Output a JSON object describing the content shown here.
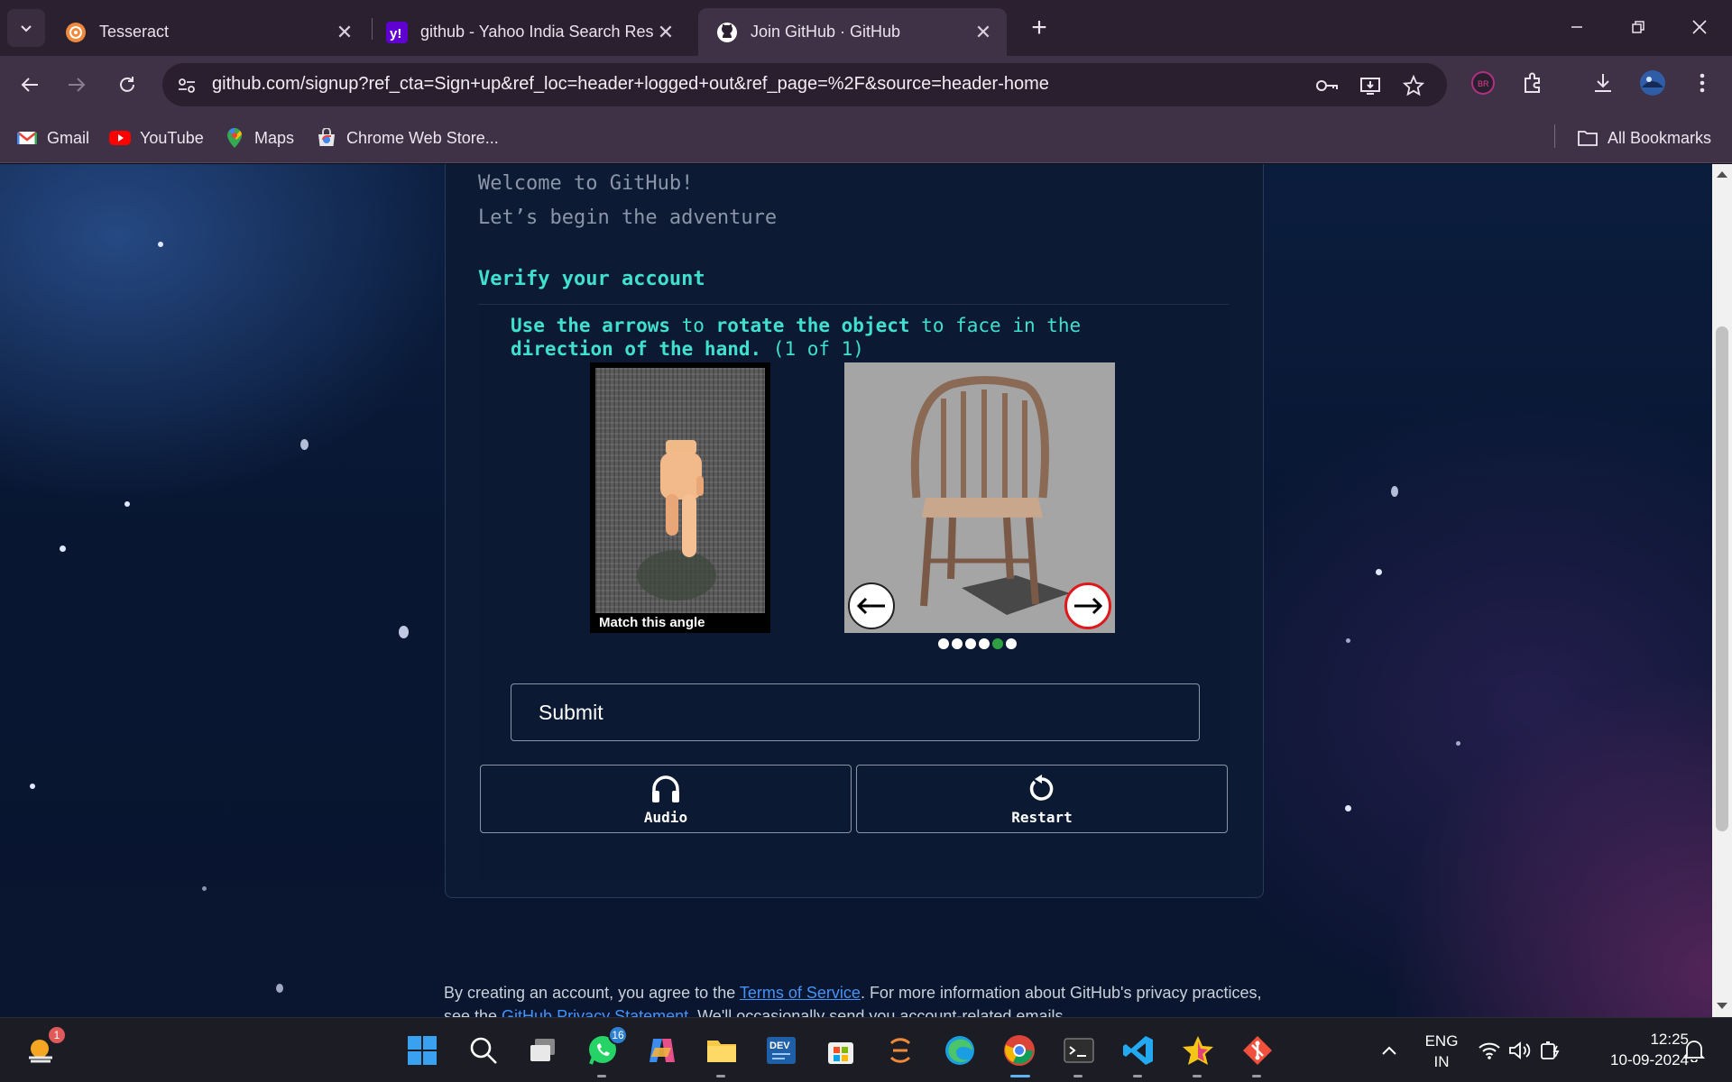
{
  "browser": {
    "tabs": [
      {
        "title": "Tesseract",
        "icon": "tesseract-icon",
        "active": false
      },
      {
        "title": "github - Yahoo India Search Res",
        "icon": "yahoo-icon",
        "active": false
      },
      {
        "title": "Join GitHub · GitHub",
        "icon": "github-icon",
        "active": true
      }
    ],
    "url": "github.com/signup?ref_cta=Sign+up&ref_loc=header+logged+out&ref_page=%2F&source=header-home",
    "bookmarks": [
      {
        "label": "Gmail",
        "icon": "gmail-icon"
      },
      {
        "label": "YouTube",
        "icon": "youtube-icon"
      },
      {
        "label": "Maps",
        "icon": "maps-icon"
      },
      {
        "label": "Chrome Web Store...",
        "icon": "chrome-web-store-icon"
      }
    ],
    "all_bookmarks": "All Bookmarks",
    "profile_badge": "BR"
  },
  "signup": {
    "welcome": "Welcome to GitHub!",
    "subtitle": "Let’s begin the adventure",
    "verify_heading": "Verify your account",
    "instruction": {
      "part1": "Use the arrows",
      "part2": " to ",
      "part3": "rotate the object",
      "part4": " to face in the ",
      "part5": "direction of the hand.",
      "part6": " (1 of 1)"
    },
    "match_label": "Match this angle",
    "progress": {
      "total": 6,
      "current": 5
    },
    "submit_label": "Submit",
    "audio_label": "Audio",
    "restart_label": "Restart",
    "terms_prefix": "By creating an account, you agree to the ",
    "terms_link": "Terms of Service",
    "terms_suffix": ". For more information about GitHub's privacy practices,",
    "terms_line2_prefix": "see the ",
    "privacy_link": "GitHub Privacy Statement",
    "terms_line2_suffix": ". We'll occasionally send you account-related emails."
  },
  "taskbar": {
    "weather_badge": "1",
    "whatsapp_badge": "16",
    "language": "ENG",
    "region": "IN",
    "time": "12:25",
    "date": "10-09-2024"
  },
  "colors": {
    "accent_teal": "#3fe0cf",
    "link_blue": "#4493f8",
    "progress_green": "#2ea043",
    "arrow_red": "#e0181b"
  }
}
